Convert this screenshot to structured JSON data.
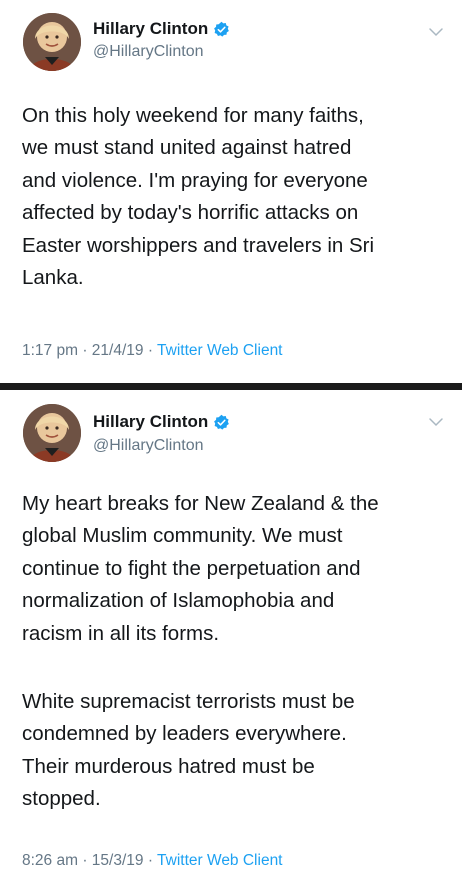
{
  "tweets": [
    {
      "display_name": "Hillary Clinton",
      "handle": "@HillaryClinton",
      "verified": true,
      "text_lines": [
        "On this holy weekend for many faiths,",
        "we must stand united against hatred",
        "and violence. I'm praying for everyone",
        "affected by today's horrific attacks on",
        "Easter worshippers and travelers in Sri",
        "Lanka."
      ],
      "time": "1:17 pm",
      "date": "21/4/19",
      "source": "Twitter Web Client"
    },
    {
      "display_name": "Hillary Clinton",
      "handle": "@HillaryClinton",
      "verified": true,
      "paragraph1_lines": [
        "My heart breaks for New Zealand & the",
        "global Muslim community. We must",
        "continue to fight the perpetuation and",
        "normalization of Islamophobia and",
        "racism in all its forms."
      ],
      "paragraph2_lines": [
        "White supremacist terrorists must be",
        "condemned by leaders everywhere.",
        "Their murderous hatred must be",
        "stopped."
      ],
      "time": "8:26 am",
      "date": "15/3/19",
      "source": "Twitter Web Client"
    }
  ],
  "separator": " · ",
  "colors": {
    "text": "#14171a",
    "secondary": "#657786",
    "link": "#1da1f2",
    "verified": "#1da1f2",
    "divider": "#1b1b1b"
  },
  "icons": {
    "verified": "verified-badge-icon",
    "menu": "chevron-down-icon"
  }
}
